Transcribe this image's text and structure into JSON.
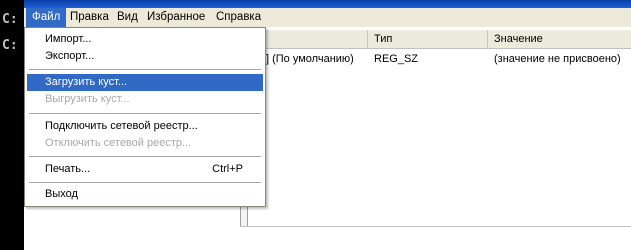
{
  "console": {
    "lines": [
      "C:",
      "C:"
    ]
  },
  "menubar": {
    "items": [
      {
        "label": "Файл",
        "active": true
      },
      {
        "label": "Правка",
        "active": false
      },
      {
        "label": "Вид",
        "active": false
      },
      {
        "label": "Избранное",
        "active": false
      },
      {
        "label": "Справка",
        "active": false
      }
    ]
  },
  "list": {
    "columns": [
      "я",
      "Тип",
      "Значение"
    ],
    "rows": [
      {
        "name": "] (По умолчанию)",
        "type": "REG_SZ",
        "value": "(значение не присвоено)"
      }
    ]
  },
  "file_menu": {
    "import": "Импорт...",
    "export": "Экспорт...",
    "load_hive": "Загрузить куст...",
    "unload_hive": "Выгрузить куст...",
    "connect_registry": "Подключить сетевой реестр...",
    "disconnect_registry": "Отключить сетевой реестр...",
    "print": "Печать...",
    "print_shortcut": "Ctrl+P",
    "exit": "Выход"
  }
}
